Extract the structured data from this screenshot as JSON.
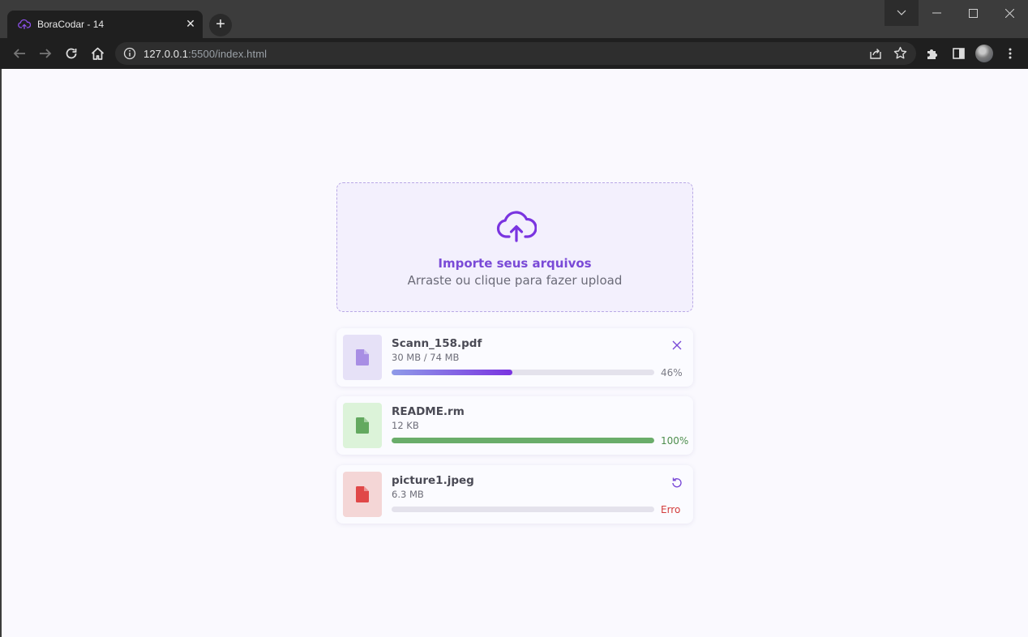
{
  "browser": {
    "tab_title": "BoraCodar - 14",
    "tab_close": "✕",
    "new_tab": "+",
    "url_host": "127.0.0.1",
    "url_path": ":5500/index.html"
  },
  "page": {
    "dropzone": {
      "title": "Importe seus arquivos",
      "subtitle": "Arraste ou clique para fazer upload"
    },
    "files": [
      {
        "name": "Scann_158.pdf",
        "size": "30 MB / 74 MB",
        "progress": 0.46,
        "progress_label": "46%",
        "status": "uploading",
        "action_icon": "close-icon",
        "thumb_bg": "#e6e1f7",
        "icon_color": "#a88ee4",
        "bar_colors": [
          "#8f9be8",
          "#7a34e0"
        ],
        "label_color": "#7b7b86"
      },
      {
        "name": "README.rm",
        "size": "12 KB",
        "progress": 1.0,
        "progress_label": "100%",
        "status": "done",
        "action_icon": "",
        "thumb_bg": "#dcf3d9",
        "icon_color": "#63a95f",
        "bar_colors": [
          "#6aad6a",
          "#6aad6a"
        ],
        "label_color": "#4d8e4d"
      },
      {
        "name": "picture1.jpeg",
        "size": "6.3 MB",
        "progress": 0,
        "progress_label": "Erro",
        "status": "error",
        "action_icon": "retry-icon",
        "thumb_bg": "#f4d6d6",
        "icon_color": "#e04848",
        "bar_colors": [
          "#e4e2ec",
          "#e4e2ec"
        ],
        "label_color": "#d33b3b"
      }
    ]
  }
}
